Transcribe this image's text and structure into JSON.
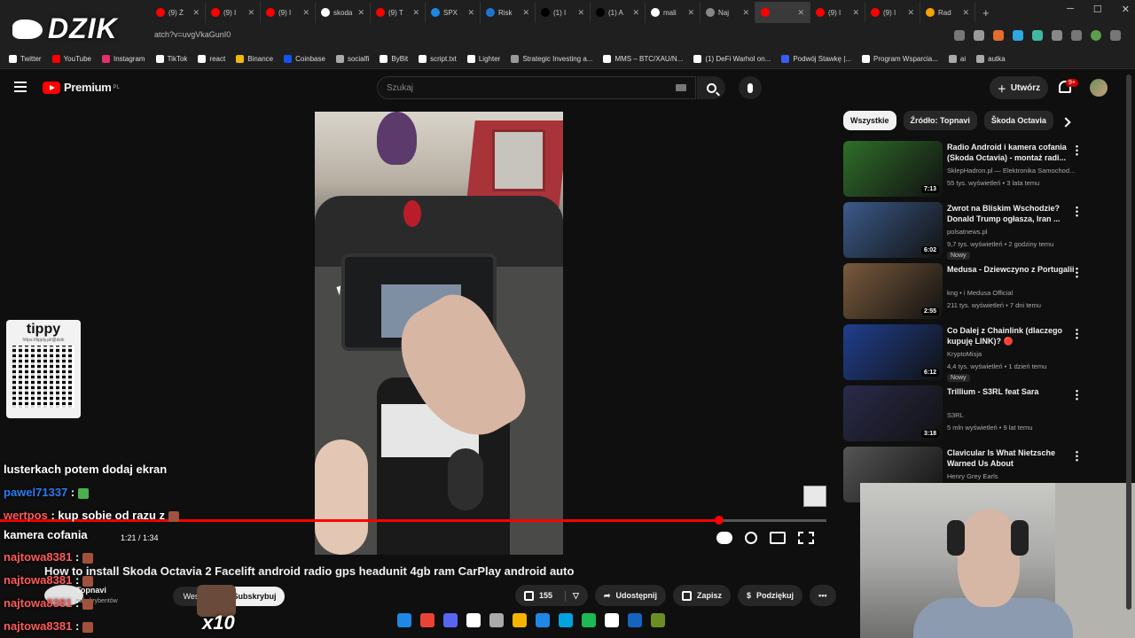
{
  "browser": {
    "tabs": [
      {
        "label": "(9) Ż",
        "icon_color": "#ff0000"
      },
      {
        "label": "(9) I",
        "icon_color": "#ff0000"
      },
      {
        "label": "(9) I",
        "icon_color": "#ff0000"
      },
      {
        "label": "skoda",
        "icon_color": "#ffffff"
      },
      {
        "label": "(9) T",
        "icon_color": "#ff0000"
      },
      {
        "label": "SPX",
        "icon_color": "#1e88e5"
      },
      {
        "label": "Risk",
        "icon_color": "#1976d2"
      },
      {
        "label": "(1) I",
        "icon_color": "#000000"
      },
      {
        "label": "(1) A",
        "icon_color": "#000000"
      },
      {
        "label": "mali",
        "icon_color": "#ffffff"
      },
      {
        "label": "Naj",
        "icon_color": "#888888"
      },
      {
        "label": "",
        "icon_color": "#ff0000"
      },
      {
        "label": "(9) I",
        "icon_color": "#ff0000"
      },
      {
        "label": "(9) I",
        "icon_color": "#ff0000"
      },
      {
        "label": "Rad",
        "icon_color": "#f4a300"
      }
    ],
    "url": "atch?v=uvgVkaGunI0",
    "bookmarks": [
      {
        "label": "Twitter",
        "icon_color": "#ffffff"
      },
      {
        "label": "YouTube",
        "icon_color": "#ff0000"
      },
      {
        "label": "Instagram",
        "icon_color": "#e1306c"
      },
      {
        "label": "TikTok",
        "icon_color": "#ffffff"
      },
      {
        "label": "react",
        "icon_color": "#ffffff"
      },
      {
        "label": "Binance",
        "icon_color": "#f0b90b"
      },
      {
        "label": "Coinbase",
        "icon_color": "#1652f0"
      },
      {
        "label": "socialfi",
        "icon_color": "#aaaaaa"
      },
      {
        "label": "ByBit",
        "icon_color": "#ffffff"
      },
      {
        "label": "script.txt",
        "icon_color": "#ffffff"
      },
      {
        "label": "Lighter",
        "icon_color": "#ffffff"
      },
      {
        "label": "Strategic Investing a...",
        "icon_color": "#999999"
      },
      {
        "label": "MMS – BTC/XAU/N...",
        "icon_color": "#ffffff"
      },
      {
        "label": "(1) DeFi Warhol on...",
        "icon_color": "#ffffff"
      },
      {
        "label": "Podwój Stawkę |...",
        "icon_color": "#3a5cff"
      },
      {
        "label": "Program Wsparcia...",
        "icon_color": "#ffffff"
      },
      {
        "label": "ai",
        "icon_color": "#aaaaaa"
      },
      {
        "label": "autka",
        "icon_color": "#aaaaaa"
      }
    ]
  },
  "overlay": {
    "logo": "DZIK",
    "tippy": {
      "title": "tippy",
      "url": "https://tipply.pl/@dzik"
    },
    "x10": "x10"
  },
  "youtube": {
    "brand": "Premium",
    "brand_sup": "PL",
    "search_placeholder": "Szukaj",
    "create_label": "Utwórz",
    "notif_count": "9+",
    "player": {
      "time": "1:21 / 1:34",
      "progress": 0.87
    },
    "title": "How to install Skoda Octavia 2 Facelift android radio gps headunit 4gb ram CarPlay android auto",
    "channel": {
      "name": "Topnavi",
      "subs": "subskrybentów"
    },
    "join_label": "Wesprzyj",
    "subscribe_label": "Subskrybuj",
    "likes": "155",
    "share_label": "Udostępnij",
    "save_label": "Zapisz",
    "thanks_label": "Podziękuj",
    "chips": [
      "Wszystkie",
      "Źródło: Topnavi",
      "Škoda Octavia"
    ],
    "recommendations": [
      {
        "title": "Radio Android i kamera cofania (Skoda Octavia) - montaż radi...",
        "channel": "SklepHadron.pl — Elektronika Samochod...",
        "meta": "55 tys. wyświetleń • 3 lata temu",
        "duration": "7:13",
        "thumb_color": "#2f6e2a",
        "new": ""
      },
      {
        "title": "Zwrot na Bliskim Wschodzie? Donald Trump ogłasza, Iran ...",
        "channel": "polsatnews.pl",
        "meta": "9,7 tys. wyświetleń • 2 godziny temu",
        "duration": "6:02",
        "thumb_color": "#3c5a8a",
        "new": "Nowy"
      },
      {
        "title": "Medusa - Dziewczyno z Portugalii",
        "channel": "kng • i Medusa Official",
        "meta": "211 tys. wyświetleń • 7 dni temu",
        "duration": "2:55",
        "thumb_color": "#7a5a3c",
        "new": ""
      },
      {
        "title": "Co Dalej z Chainlink (dlaczego kupuję LINK)? 🔴",
        "channel": "KryptoMisja",
        "meta": "4,4 tys. wyświetleń • 1 dzień temu",
        "duration": "6:12",
        "thumb_color": "#1f3f8f",
        "new": "Nowy"
      },
      {
        "title": "Trillium - S3RL feat Sara",
        "channel": "S3RL",
        "meta": "5 mln wyświetleń • 9 lat temu",
        "duration": "3:18",
        "thumb_color": "#2a2a4a",
        "new": ""
      },
      {
        "title": "Clavicular Is What Nietzsche Warned Us About",
        "channel": "Henry Grey Earls",
        "meta": "",
        "duration": "",
        "thumb_color": "#555555",
        "new": ""
      }
    ]
  },
  "chat": [
    {
      "user": "",
      "text": "lusterkach potem dodaj ekran"
    },
    {
      "user": "pawel71337",
      "text": ":"
    },
    {
      "user": "wertpos",
      "text": ": kup sobie od razu z"
    },
    {
      "user": "",
      "text": "kamera cofania"
    },
    {
      "user": "najtowa8381",
      "text": ":"
    },
    {
      "user": "najtowa8381",
      "text": ":"
    },
    {
      "user": "najtowa8381",
      "text": ":"
    },
    {
      "user": "najtowa8381",
      "text": ":"
    }
  ],
  "taskbar": [
    "#1e88e5",
    "#ea4335",
    "#5865f2",
    "#ffffff",
    "#aaaaaa",
    "#f4b400",
    "#1e88e5",
    "#00a3e0",
    "#1db954",
    "#ffffff",
    "#1565c0",
    "#6b8e23"
  ]
}
